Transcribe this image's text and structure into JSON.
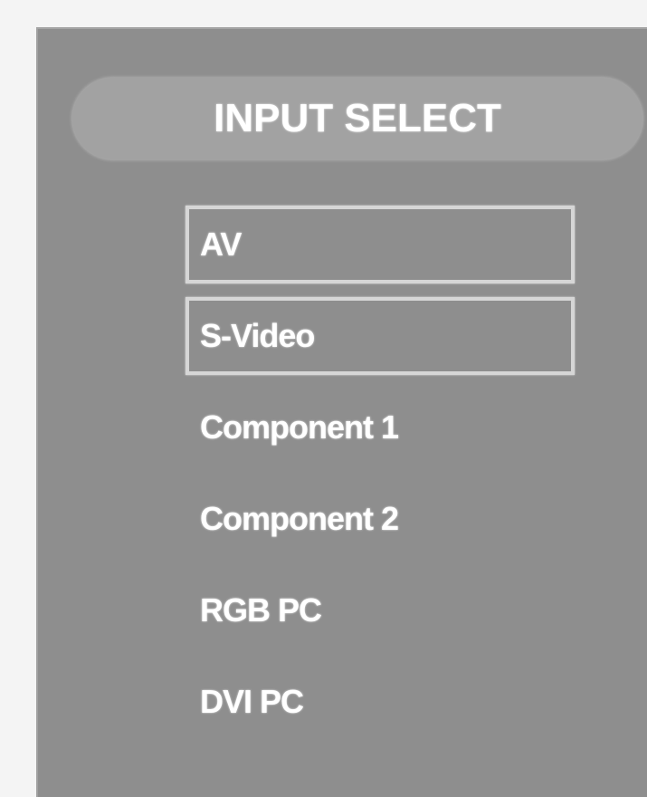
{
  "menu": {
    "title": "INPUT SELECT",
    "items": [
      {
        "label": "AV",
        "boxed": true
      },
      {
        "label": "S-Video",
        "boxed": true
      },
      {
        "label": "Component 1",
        "boxed": false
      },
      {
        "label": "Component 2",
        "boxed": false
      },
      {
        "label": "RGB PC",
        "boxed": false
      },
      {
        "label": "DVI PC",
        "boxed": false
      }
    ]
  },
  "colors": {
    "panel": "#8e8e8e",
    "title_bar": "#a2a2a2",
    "text": "#ffffff",
    "item_border": "#d6d6d6"
  }
}
